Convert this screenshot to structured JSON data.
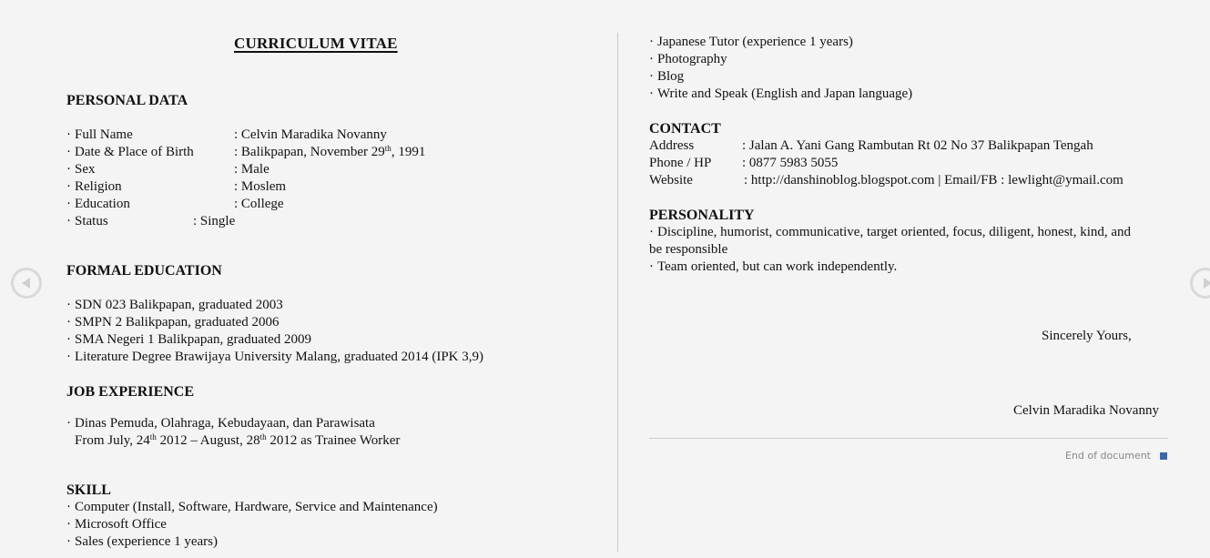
{
  "title": "CURRICULUM VITAE",
  "personal_data": {
    "heading": "PERSONAL DATA",
    "rows": [
      {
        "label": "Full Name",
        "value": ": Celvin Maradika Novanny"
      },
      {
        "label": "Date & Place of Birth",
        "value_prefix": ": Balikpapan, November 29",
        "value_sup": "th",
        "value_suffix": ", 1991"
      },
      {
        "label": "Sex",
        "value": ": Male"
      },
      {
        "label": "Religion",
        "value": ": Moslem"
      },
      {
        "label": "Education",
        "value": ": College"
      },
      {
        "label": "Status",
        "value": ": Single"
      }
    ]
  },
  "formal_education": {
    "heading": "FORMAL EDUCATION",
    "items": [
      "SDN 023 Balikpapan, graduated 2003",
      "SMPN 2 Balikpapan, graduated 2006",
      "SMA Negeri 1 Balikpapan, graduated 2009",
      "Literature Degree Brawijaya University Malang, graduated 2014  (IPK 3,9)"
    ]
  },
  "job_experience": {
    "heading": "JOB EXPERIENCE",
    "employer": "Dinas Pemuda, Olahraga, Kebudayaan, dan Parawisata",
    "period_a": "From July, 24",
    "sup_a": "th",
    "period_b": " 2012 – August, 28",
    "sup_b": "th",
    "period_c": " 2012 as Trainee Worker"
  },
  "skill": {
    "heading": "SKILL",
    "items": [
      "Computer (Install, Software, Hardware, Service and Maintenance)",
      "Microsoft Office",
      "Sales (experience 1 years)",
      "Japanese Tutor (experience 1 years)",
      "Photography",
      "Blog",
      "Write and Speak (English and Japan language)"
    ]
  },
  "contact": {
    "heading": "CONTACT",
    "rows": [
      {
        "label": "Address",
        "value": ": Jalan A. Yani Gang Rambutan Rt 02 No 37 Balikpapan Tengah"
      },
      {
        "label": "Phone / HP",
        "value": ": 0877 5983 5055"
      },
      {
        "label": "Website",
        "value": ": http://danshinoblog.blogspot.com | Email/FB : lewlight@ymail.com"
      }
    ]
  },
  "personality": {
    "heading": "PERSONALITY",
    "line1": "Discipline, humorist, communicative, target oriented, focus, diligent, honest, kind, and",
    "line1_wrap": "be responsible",
    "line2": "Team oriented, but can work independently."
  },
  "closing": {
    "salutation": "Sincerely Yours,",
    "signature": "Celvin Maradika Novanny"
  },
  "viewer": {
    "end_label": "End of document",
    "end_marker_color": "#3b67a8",
    "prev_icon": "chevron-left-circle",
    "next_icon": "chevron-right-circle"
  }
}
